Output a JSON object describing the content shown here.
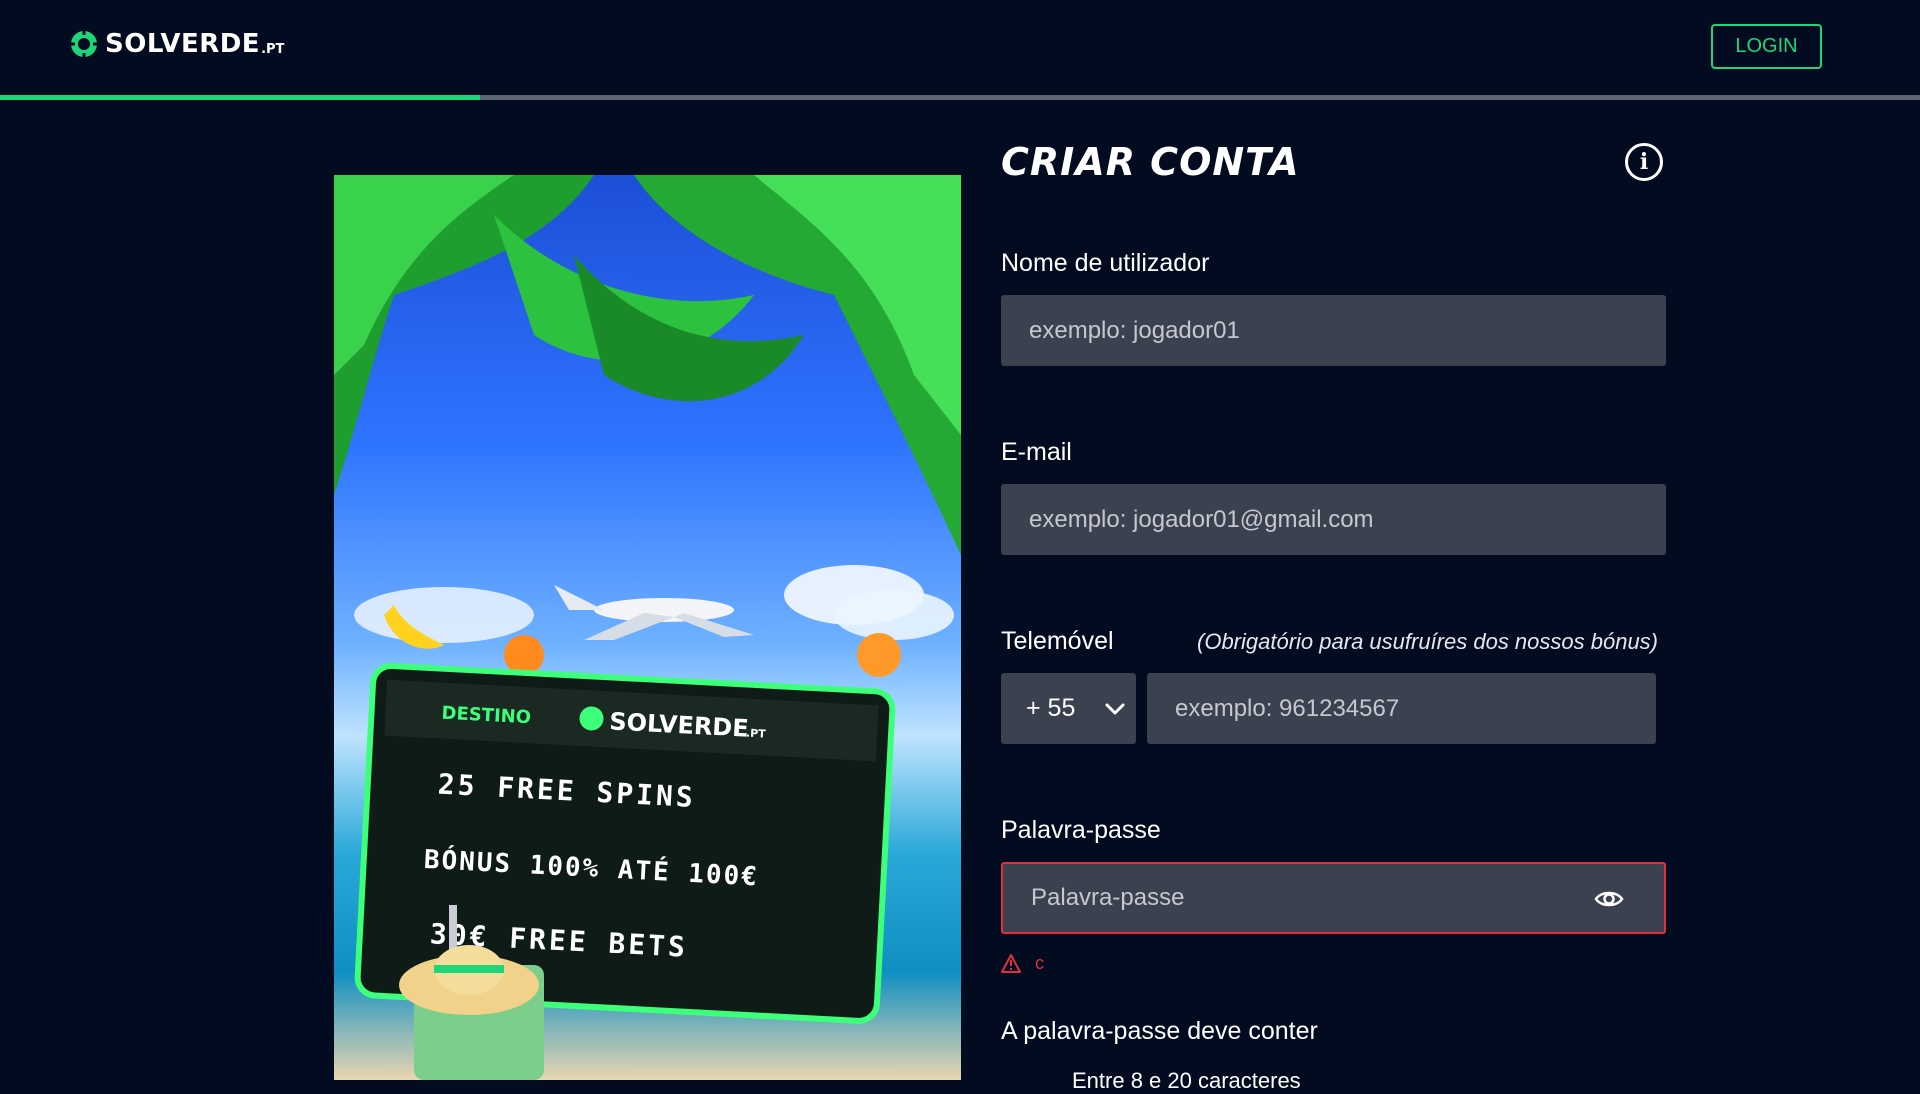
{
  "header": {
    "logo_text": "SOLVERDE",
    "logo_suffix": ".PT",
    "login_label": "LOGIN",
    "progress_fraction": 0.25
  },
  "promo": {
    "board_destination": "DESTINO",
    "board_brand": "SOLVERDE",
    "board_brand_suffix": ".PT",
    "line1": "25 FREE SPINS",
    "line2": "BÓNUS 100% ATÉ 100€",
    "line3": "30€ FREE BETS"
  },
  "form": {
    "title": "CRIAR CONTA",
    "info_icon": "info-icon",
    "username": {
      "label": "Nome de utilizador",
      "placeholder": "exemplo: jogador01"
    },
    "email": {
      "label": "E-mail",
      "placeholder": "exemplo: jogador01@gmail.com"
    },
    "phone": {
      "label": "Telemóvel",
      "note": "(Obrigatório para usufruíres dos nossos bónus)",
      "country_code": "+ 55",
      "placeholder": "exemplo: 961234567"
    },
    "password": {
      "label": "Palavra-passe",
      "placeholder": "Palavra-passe",
      "error": "c",
      "requirements_title": "A palavra-passe deve conter",
      "requirement_1": "Entre 8 e 20 caracteres"
    }
  },
  "colors": {
    "background": "#020b1f",
    "accent": "#1ed67a",
    "field": "#3c4150",
    "error": "#e0303e"
  }
}
